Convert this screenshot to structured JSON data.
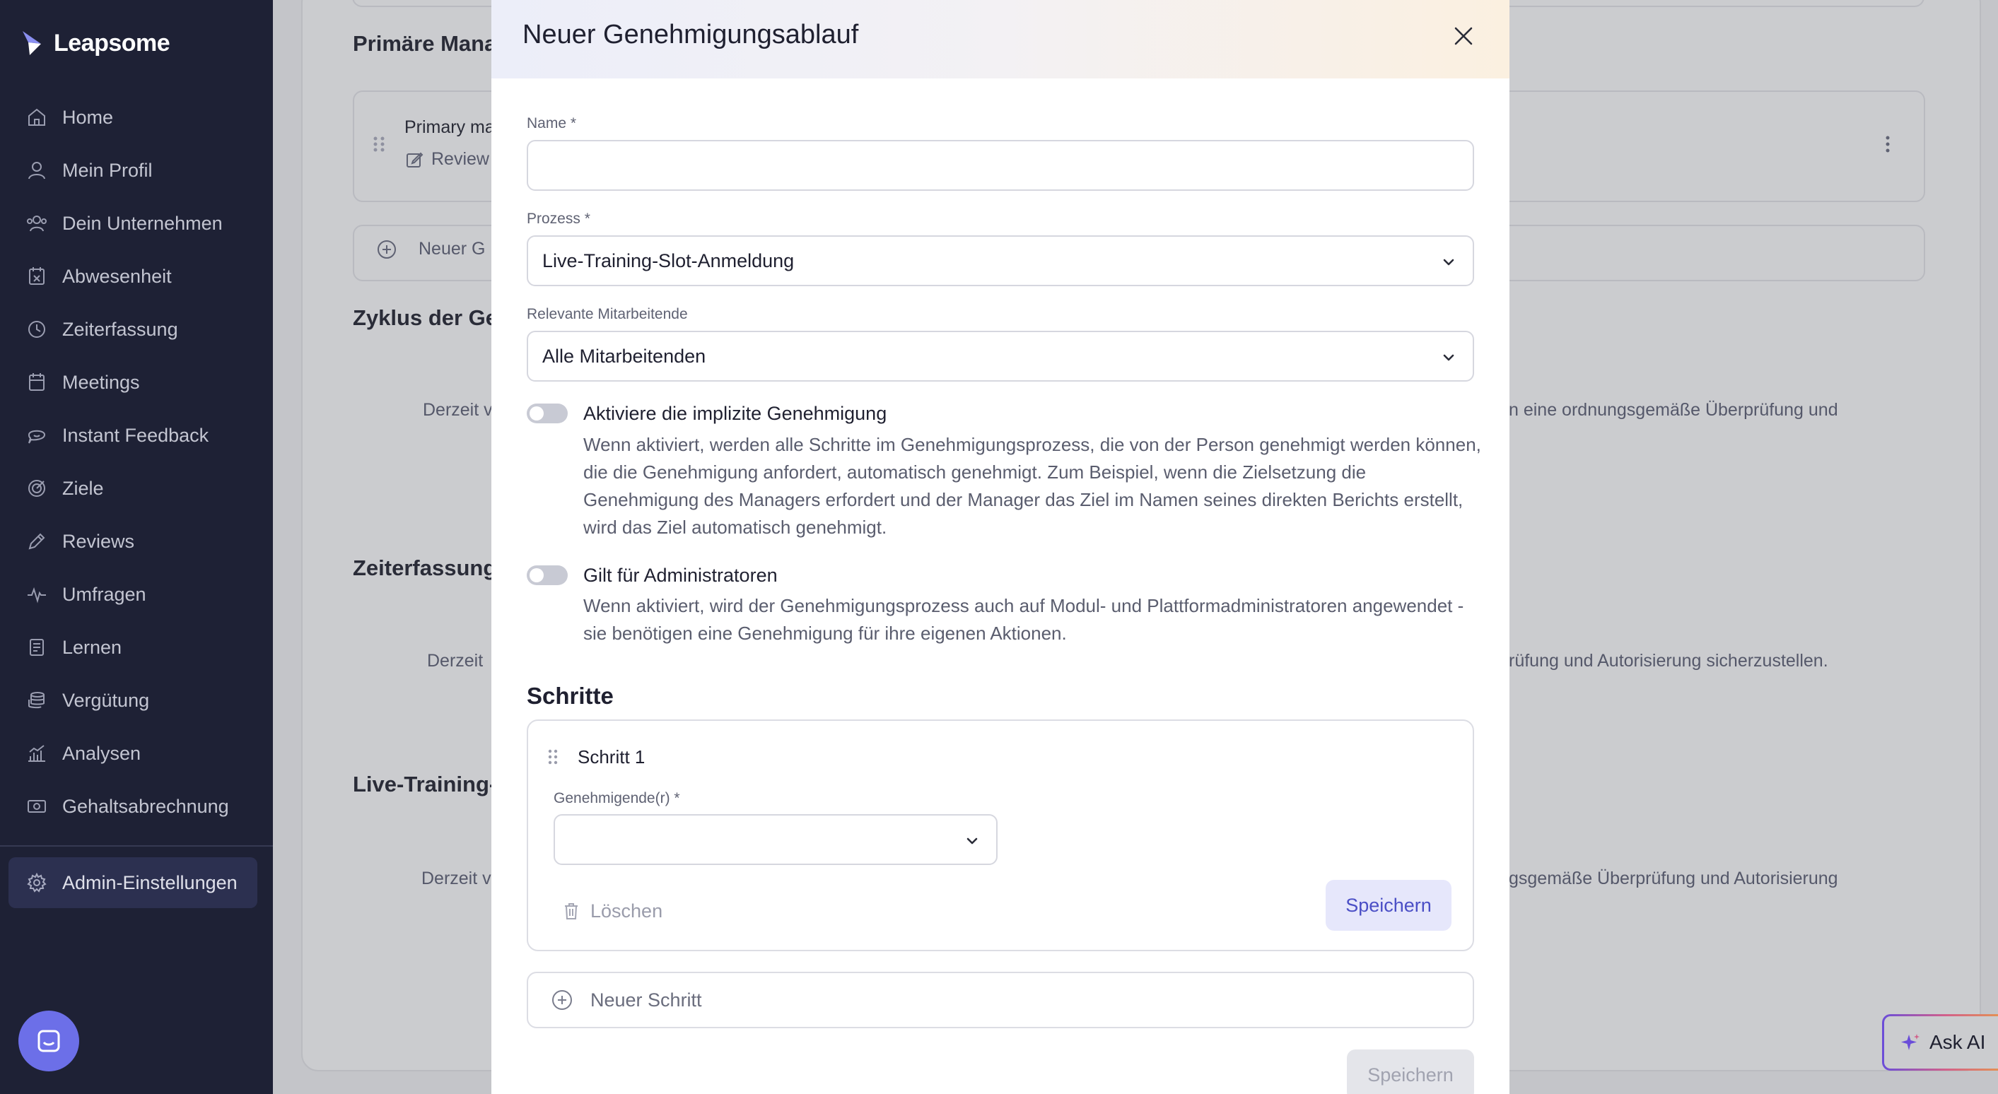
{
  "brand": {
    "name": "Leapsome"
  },
  "sidebar": {
    "items": [
      {
        "label": "Home",
        "icon": "home-icon"
      },
      {
        "label": "Mein Profil",
        "icon": "user-icon"
      },
      {
        "label": "Dein Unternehmen",
        "icon": "users-icon"
      },
      {
        "label": "Abwesenheit",
        "icon": "calendar-x-icon"
      },
      {
        "label": "Zeiterfassung",
        "icon": "clock-icon"
      },
      {
        "label": "Meetings",
        "icon": "calendar-icon"
      },
      {
        "label": "Instant Feedback",
        "icon": "chat-icon"
      },
      {
        "label": "Ziele",
        "icon": "target-icon"
      },
      {
        "label": "Reviews",
        "icon": "pencil-icon"
      },
      {
        "label": "Umfragen",
        "icon": "pulse-icon"
      },
      {
        "label": "Lernen",
        "icon": "book-icon"
      },
      {
        "label": "Vergütung",
        "icon": "coins-icon"
      },
      {
        "label": "Analysen",
        "icon": "chart-icon"
      },
      {
        "label": "Gehaltsabrechnung",
        "icon": "money-icon"
      }
    ],
    "admin": {
      "label": "Admin-Einstellungen",
      "icon": "gear-icon"
    }
  },
  "background": {
    "section1_title": "Primäre Mana",
    "flow_name": "Primary ma",
    "flow_sub": "Review",
    "new_flow": "Neuer G",
    "section2_title": "Zyklus der Ge",
    "section2_empty_left": "Derzeit v",
    "section2_empty_right": "n eine ordnungsgemäße Überprüfung und",
    "section3_title": "Zeiterfassung",
    "section3_empty_left": "Derzeit",
    "section3_empty_right": "rüfung und Autorisierung sicherzustellen.",
    "section4_title": "Live-Training-",
    "section4_empty_left": "Derzeit v",
    "section4_empty_right": "gsgemäße Überprüfung und Autorisierung"
  },
  "modal": {
    "title": "Neuer Genehmigungsablauf",
    "name_label": "Name *",
    "name_value": "",
    "process_label": "Prozess *",
    "process_value": "Live-Training-Slot-Anmeldung",
    "employees_label": "Relevante Mitarbeitende",
    "employees_value": "Alle Mitarbeitenden",
    "implicit_toggle": {
      "title": "Aktiviere die implizite Genehmigung",
      "description": "Wenn aktiviert, werden alle Schritte im Genehmigungsprozess, die von der Person genehmigt werden können, die die Genehmigung anfordert, automatisch genehmigt. Zum Beispiel, wenn die Zielsetzung die Genehmigung des Managers erfordert und der Manager das Ziel im Namen seines direkten Berichts erstellt, wird das Ziel automatisch genehmigt.",
      "enabled": false
    },
    "admin_toggle": {
      "title": "Gilt für Administratoren",
      "description": "Wenn aktiviert, wird der Genehmigungsprozess auch auf Modul- und Plattformadministratoren angewendet - sie benötigen eine Genehmigung für ihre eigenen Aktionen.",
      "enabled": false
    },
    "steps_title": "Schritte",
    "step": {
      "title": "Schritt 1",
      "approver_label": "Genehmigende(r) *",
      "approver_value": "",
      "delete_label": "Löschen",
      "save_label": "Speichern"
    },
    "new_step_label": "Neuer Schritt",
    "footer_save_label": "Speichern"
  },
  "ask_ai": {
    "label": "Ask AI"
  },
  "colors": {
    "sidebar_bg": "#1e2135",
    "accent": "#4b4fc6",
    "chat_bubble": "#6c6fe8"
  }
}
